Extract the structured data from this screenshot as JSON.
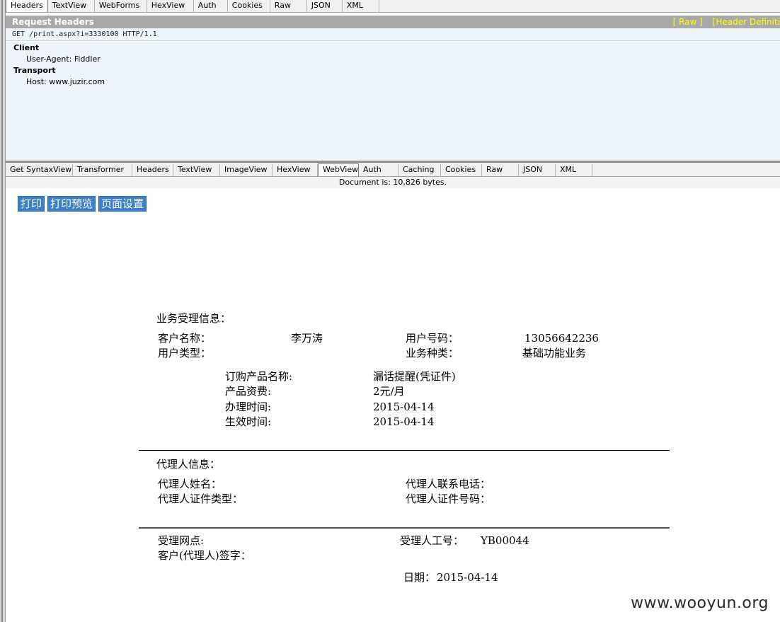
{
  "request_tabs": [
    "Headers",
    "TextView",
    "WebForms",
    "HexView",
    "Auth",
    "Cookies",
    "Raw",
    "JSON",
    "XML"
  ],
  "request_header_bar": {
    "title": "Request Headers",
    "raw_link": "[ Raw ]",
    "definitions_link": "[Header Definiti"
  },
  "request_line": "GET /print.aspx?i=3330100 HTTP/1.1",
  "header_groups": [
    {
      "title": "Client",
      "items": [
        "User-Agent: Fiddler"
      ]
    },
    {
      "title": "Transport",
      "items": [
        "Host: www.juzir.com"
      ]
    }
  ],
  "response_tabs": [
    "Get SyntaxView",
    "Transformer",
    "Headers",
    "TextView",
    "ImageView",
    "HexView",
    "WebView",
    "Auth",
    "Caching",
    "Cookies",
    "Raw",
    "JSON",
    "XML"
  ],
  "document_size": "Document is: 10,826 bytes.",
  "print_buttons": [
    "打印",
    "打印预览",
    "页面设置"
  ],
  "receipt": {
    "business_section_title": "业务受理信息：",
    "customer_name_label": "客户名称：",
    "customer_name_value": "李万涛",
    "user_number_label": "用户号码：",
    "user_number_value": "13056642236",
    "user_type_label": "用户类型：",
    "business_type_label": "业务种类：",
    "business_type_value": "基础功能业务",
    "product_name_label": "订购产品名称:",
    "product_name_value": "漏话提醒(凭证件)",
    "product_fee_label": "产品资费:",
    "product_fee_value": "2元/月",
    "handle_time_label": "办理时间:",
    "handle_time_value": "2015-04-14",
    "effective_time_label": "生效时间:",
    "effective_time_value": "2015-04-14",
    "agent_section_title": "代理人信息：",
    "agent_name_label": "代理人姓名：",
    "agent_phone_label": "代理人联系电话：",
    "agent_id_type_label": "代理人证件类型：",
    "agent_id_number_label": "代理人证件号码：",
    "outlet_label": "受理网点:",
    "staff_id_label": "受理人工号：",
    "staff_id_value": "YB00044",
    "signature_label": "客户(代理人)签字：",
    "date_label": "日期：",
    "date_value": "2015-04-14"
  },
  "watermark": "www.wooyun.org"
}
